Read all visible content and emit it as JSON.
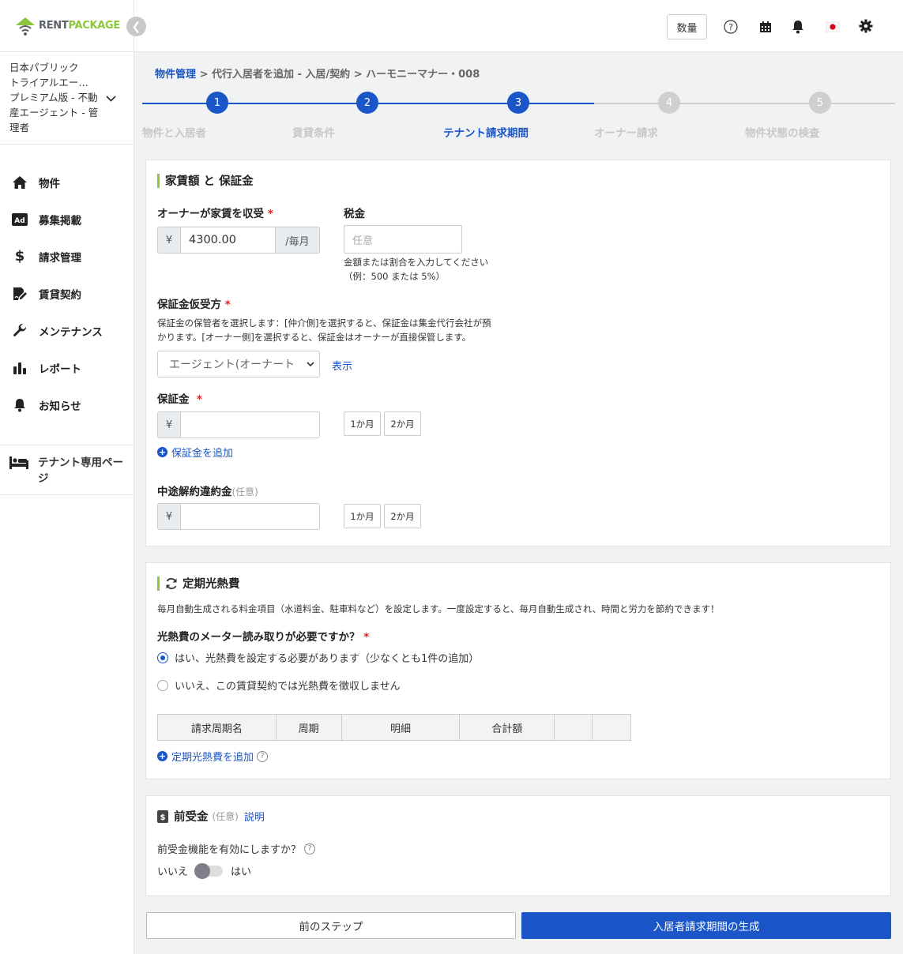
{
  "brand": {
    "name_a": "RENT",
    "name_b": "PACKAGE",
    "gray": "#5b6068",
    "green": "#8cc63f"
  },
  "colors": {
    "primary": "#1a56c8",
    "accent_bar": "#8cc63f",
    "inactive_step": "#cfcfcf"
  },
  "account": {
    "line1": "日本パブリック",
    "line2": "トライアルエー…",
    "line3": "プレミアム版 - 不動",
    "line4": "産エージェント - 管",
    "line5": "理者"
  },
  "sidebar": {
    "items": [
      {
        "label": "物件",
        "icon": "home-icon"
      },
      {
        "label": "募集掲載",
        "icon": "ad-icon"
      },
      {
        "label": "請求管理",
        "icon": "dollar-icon"
      },
      {
        "label": "賃貸契約",
        "icon": "contract-icon"
      },
      {
        "label": "メンテナンス",
        "icon": "wrench-icon"
      },
      {
        "label": "レポート",
        "icon": "bar-chart-icon"
      },
      {
        "label": "お知らせ",
        "icon": "bell-icon"
      }
    ],
    "tenant_page": "テナント専用ページ"
  },
  "header": {
    "qty_button": "数量",
    "icons": [
      "help-icon",
      "calendar-icon",
      "bell-icon",
      "japan-flag-icon",
      "gear-icon"
    ]
  },
  "breadcrumb": {
    "root": "物件管理",
    "sep": " > ",
    "mid": "代行入居者を追加 - 入居/契約",
    "last": "ハーモニーマナー・008"
  },
  "steps": [
    {
      "num": "1",
      "label": "物件と入居者",
      "state": "done"
    },
    {
      "num": "2",
      "label": "賃貸条件",
      "state": "done"
    },
    {
      "num": "3",
      "label": "テナント請求期間",
      "state": "current"
    },
    {
      "num": "4",
      "label": "オーナー請求",
      "state": "todo"
    },
    {
      "num": "5",
      "label": "物件状態の検査",
      "state": "todo"
    }
  ],
  "rent": {
    "title": "家賃額 と 保証金",
    "owner_label": "オーナーが家賃を収受",
    "required_mark": "*",
    "yen": "¥",
    "owner_value": "4300.00",
    "per_month": "/毎月",
    "tax_label": "税金",
    "tax_placeholder": "任意",
    "tax_hint1": "金額または割合を入力してください",
    "tax_hint2": "（例：500 または 5%）",
    "deposit_holder_label": "保証金仮受方",
    "deposit_holder_hint1": "保証金の保管者を選択します：[仲介側]を選択すると、保証金は集金代行会社が預",
    "deposit_holder_hint2": "かります。[オーナー側]を選択すると、保証金はオーナーが直接保管します。",
    "deposit_holder_value": "エージェント(オーナート",
    "show_link": "表示",
    "deposit_label": "保証金",
    "one_month": "1か月",
    "two_month": "2か月",
    "add_deposit": "保証金を追加",
    "penalty_label": "中途解約違約金",
    "optional": "(任意)"
  },
  "utilities": {
    "title": "定期光熱費",
    "desc": "毎月自動生成される料金項目（水道料金、駐車料など）を設定します。一度設定すると、毎月自動生成され、時間と労力を節約できます！",
    "question": "光熱費のメーター読み取りが必要ですか？",
    "required_mark": "*",
    "opt_yes": "はい、光熱費を設定する必要があります（少なくとも1件の追加）",
    "opt_no": "いいえ、この賃貸契約では光熱費を徴収しません",
    "selected": "yes",
    "columns": [
      "請求周期名",
      "周期",
      "明細",
      "合計額",
      "",
      ""
    ],
    "add_link": "定期光熱費を追加"
  },
  "prepay": {
    "title": "前受金",
    "optional": "(任意)",
    "explain": "説明",
    "question": "前受金機能を有効にしますか？",
    "no": "いいえ",
    "yes": "はい",
    "enabled": false
  },
  "buttons": {
    "prev": "前のステップ",
    "next": "入居者請求期間の生成"
  }
}
